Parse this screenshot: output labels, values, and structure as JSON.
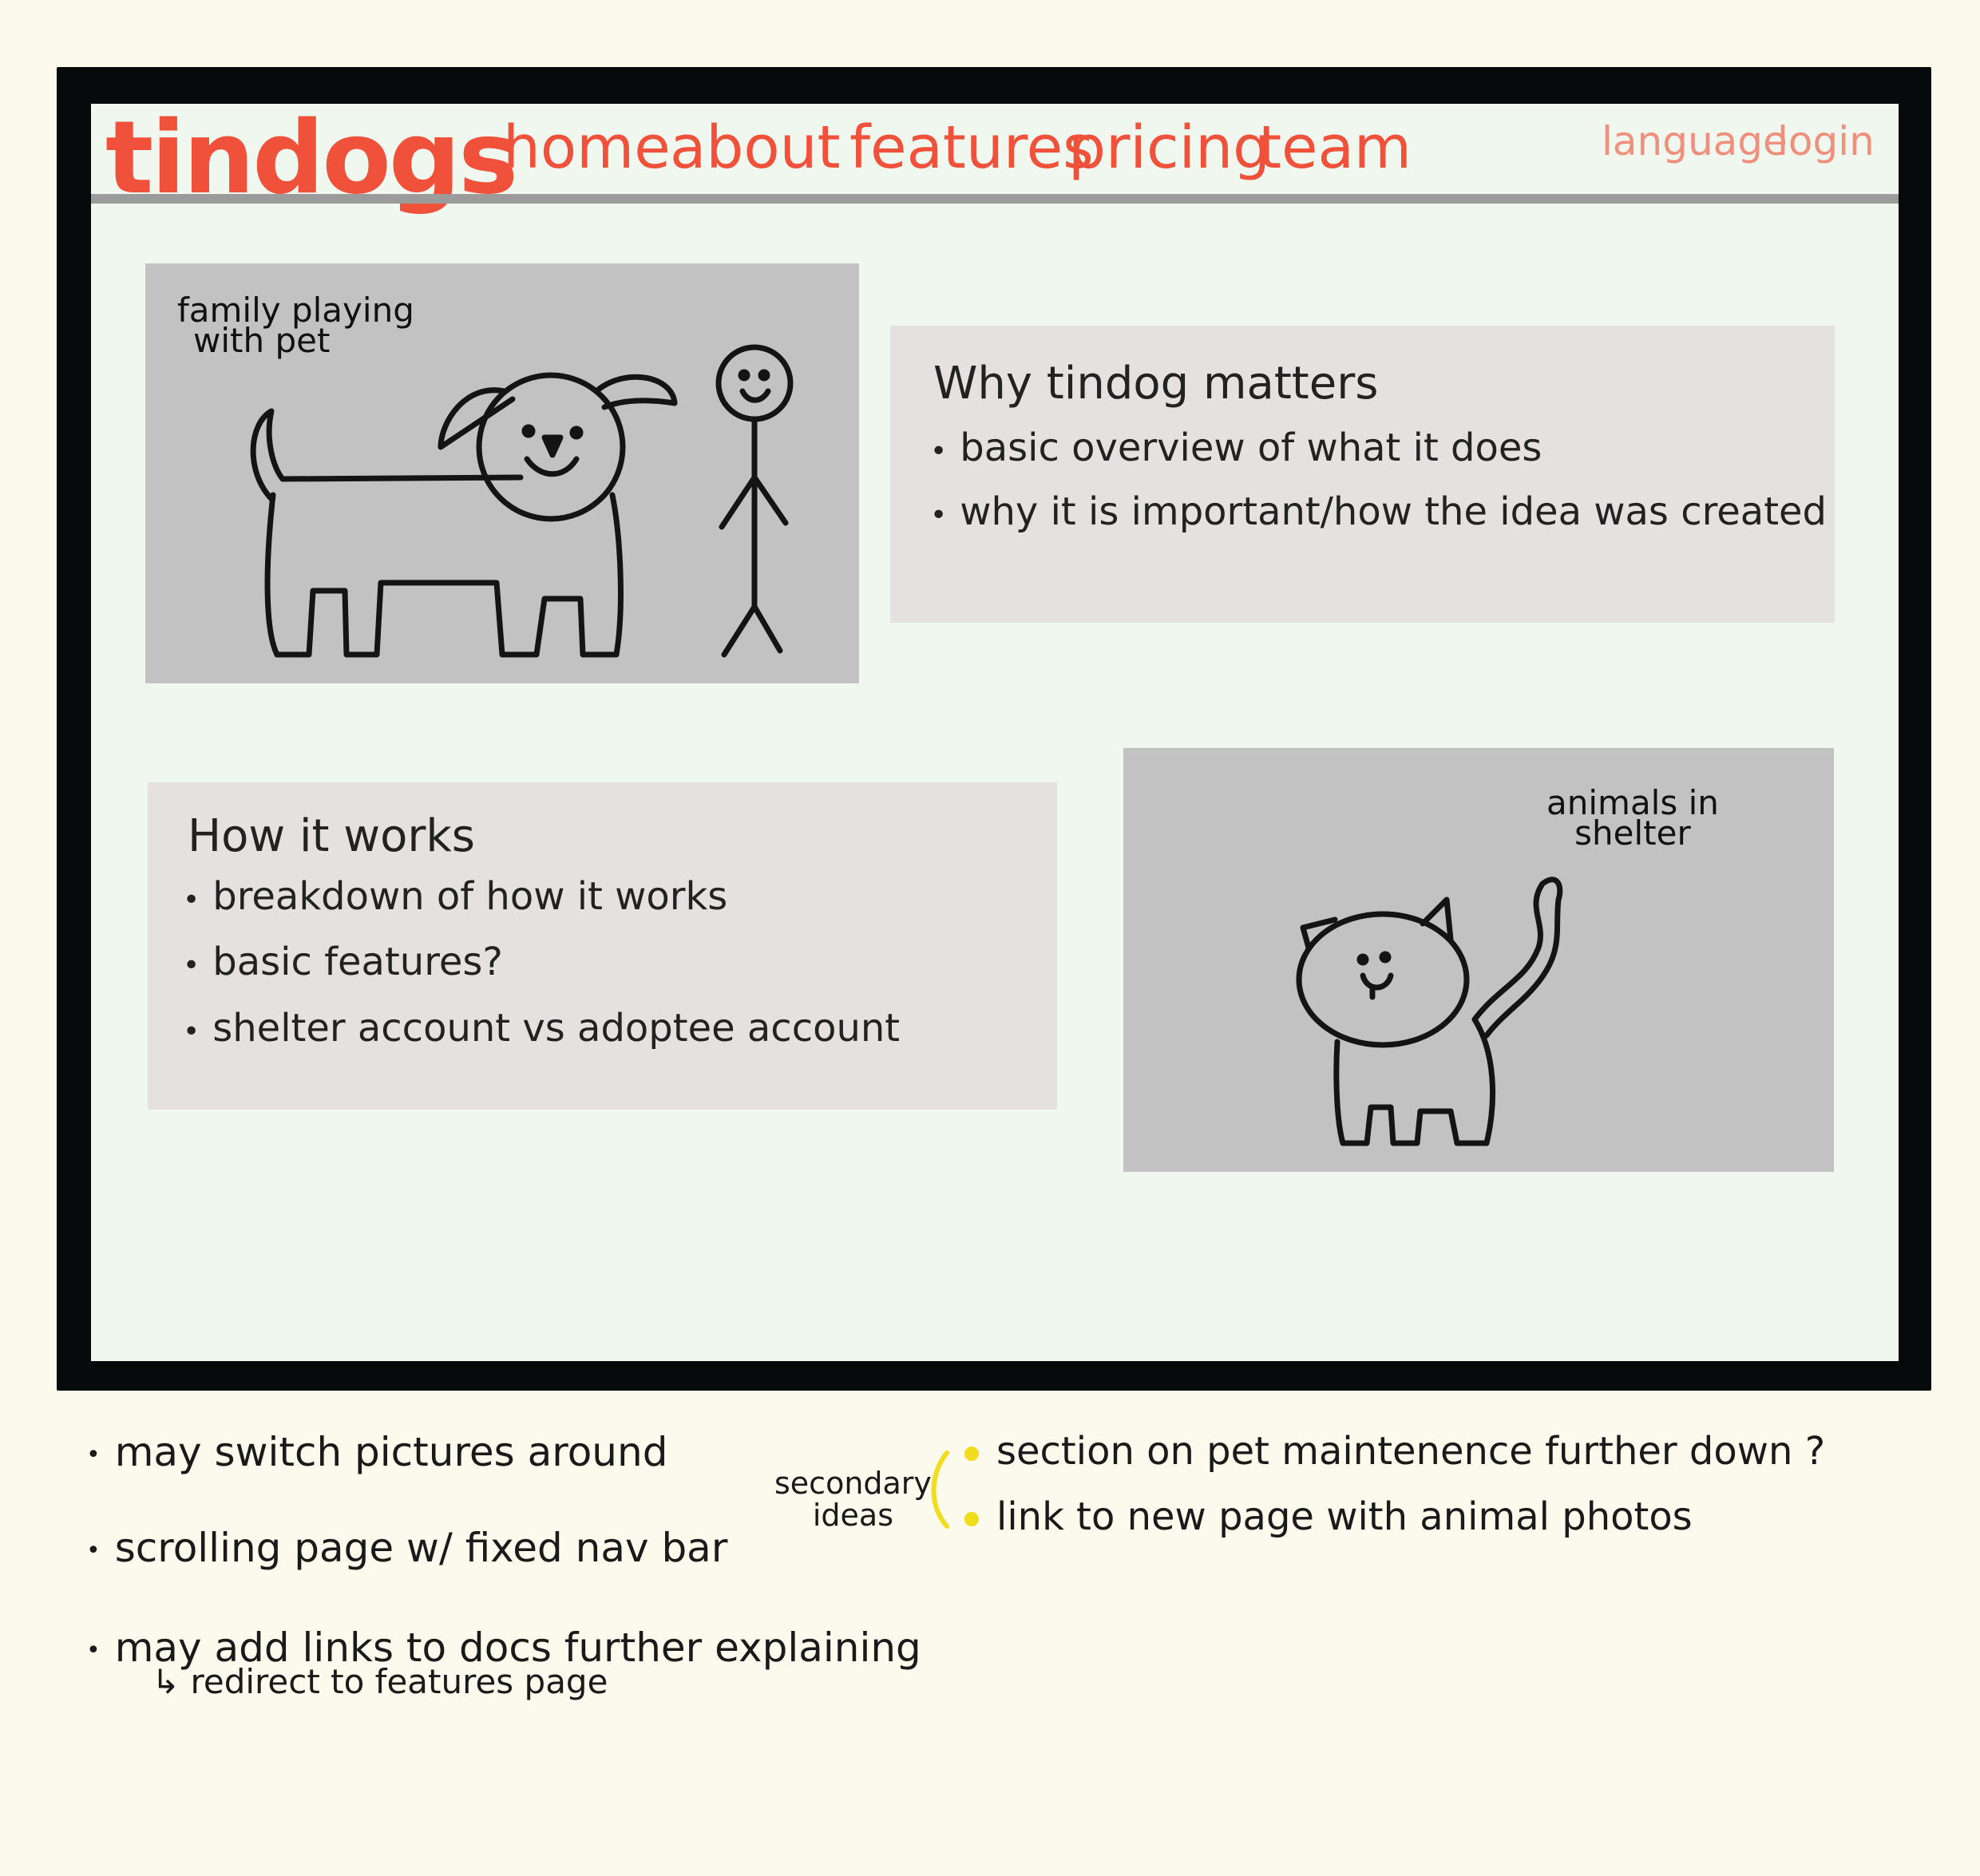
{
  "nav": {
    "logo": "tindogs",
    "links": [
      "home",
      "about",
      "features",
      "pricing",
      "team"
    ],
    "right_links": [
      "language",
      "login"
    ]
  },
  "hero_image": {
    "caption_line1": "family playing",
    "caption_line2": "with pet"
  },
  "why_card": {
    "title": "Why tindog matters",
    "bullets": [
      "basic overview of what it does",
      "why it is important/how the idea was created"
    ]
  },
  "how_card": {
    "title": "How it works",
    "bullets": [
      "breakdown of how it works",
      "basic features?",
      "shelter account vs adoptee account"
    ]
  },
  "shelter_image": {
    "caption_line1": "animals in",
    "caption_line2": "shelter"
  },
  "notes": {
    "items": [
      "may switch pictures around",
      "scrolling page w/ fixed nav bar",
      "may add links to docs further explaining"
    ],
    "sub_note": "↳ redirect to features page",
    "secondary_label_line1": "secondary",
    "secondary_label_line2": "ideas",
    "secondary_items": [
      "section on pet maintenence further down ?",
      "link to new page with animal photos"
    ]
  },
  "colors": {
    "accent": "#f0513a",
    "accent_light": "#f0907c",
    "highlight": "#f2dc1e",
    "page_bg": "#fbfaec",
    "screen_bg": "#f0f7ef"
  }
}
